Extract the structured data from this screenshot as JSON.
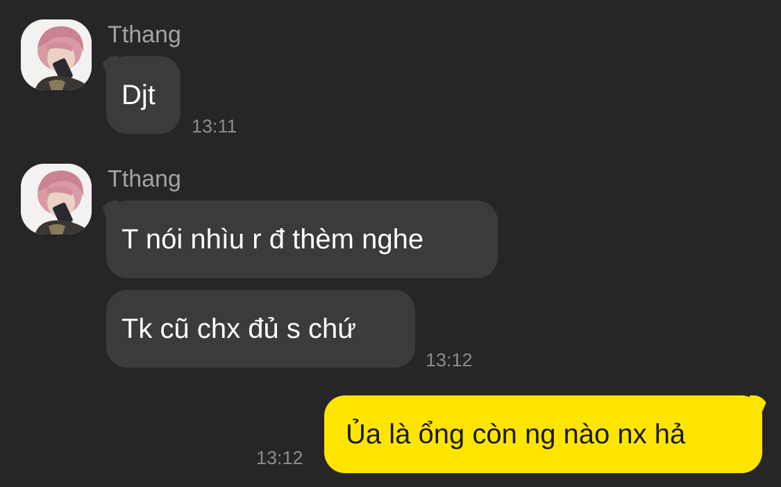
{
  "messages": [
    {
      "sender": "Tthang",
      "text": "Djt",
      "time": "13:11"
    },
    {
      "sender": "Tthang",
      "text": "T nói nhìu r đ thèm nghe",
      "time": ""
    },
    {
      "sender": "",
      "text": "Tk cũ chx đủ s chứ",
      "time": "13:12"
    },
    {
      "sender": "me",
      "text": "Ủa là ổng còn ng nào nx hả",
      "time": "13:12"
    }
  ],
  "colors": {
    "background": "#262628",
    "incoming_bubble": "#3b3b3d",
    "outgoing_bubble": "#fee500",
    "sender_name": "#a4a4a6",
    "timestamp": "#8c8c8e"
  },
  "icons": {
    "avatar": "profile-photo-pink-hair-phone"
  }
}
